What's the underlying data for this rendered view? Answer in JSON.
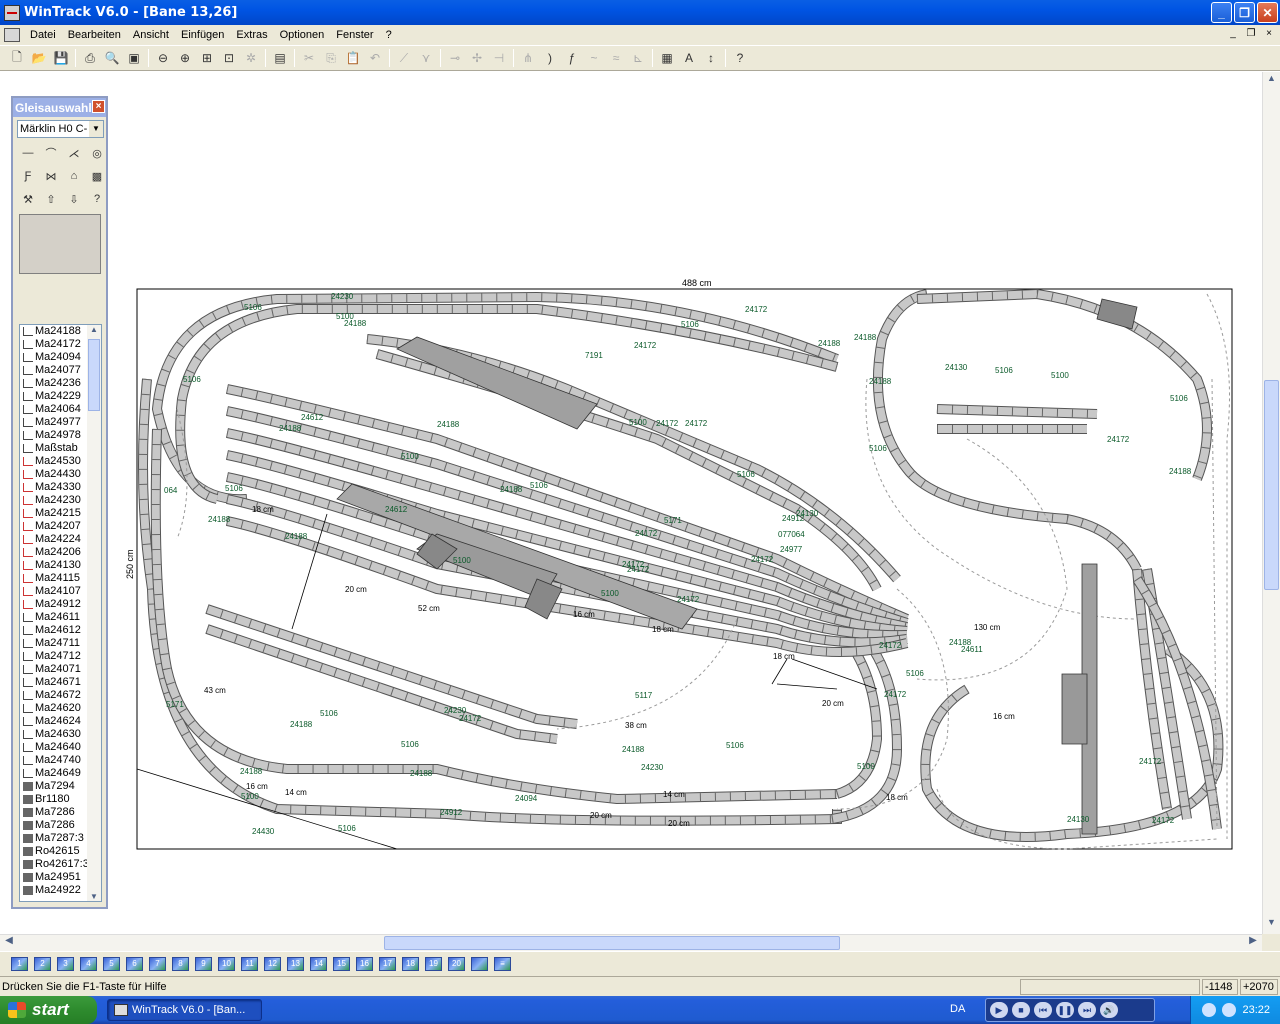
{
  "window": {
    "title": "WinTrack  V6.0 - [Bane 13,26]"
  },
  "menu": [
    "Datei",
    "Bearbeiten",
    "Ansicht",
    "Einfügen",
    "Extras",
    "Optionen",
    "Fenster",
    "?"
  ],
  "toolbar": [
    {
      "name": "new-icon",
      "glyph": "🗋"
    },
    {
      "name": "open-icon",
      "glyph": "📂"
    },
    {
      "name": "save-icon",
      "glyph": "💾"
    },
    {
      "sep": true
    },
    {
      "name": "print-icon",
      "glyph": "⎙"
    },
    {
      "name": "print-preview-icon",
      "glyph": "🔍"
    },
    {
      "name": "image-icon",
      "glyph": "▣"
    },
    {
      "sep": true
    },
    {
      "name": "zoom-out-icon",
      "glyph": "⊖"
    },
    {
      "name": "zoom-in-icon",
      "glyph": "⊕"
    },
    {
      "name": "zoom-window-icon",
      "glyph": "⊞"
    },
    {
      "name": "zoom-fit-icon",
      "glyph": "⊡"
    },
    {
      "name": "zoom-all-icon",
      "glyph": "✲",
      "dis": true
    },
    {
      "sep": true
    },
    {
      "name": "parts-list-icon",
      "glyph": "▤"
    },
    {
      "sep": true
    },
    {
      "name": "cut-icon",
      "glyph": "✂",
      "dis": true
    },
    {
      "name": "copy-icon",
      "glyph": "⎘",
      "dis": true
    },
    {
      "name": "paste-icon",
      "glyph": "📋",
      "dis": true
    },
    {
      "name": "undo-icon",
      "glyph": "↶",
      "dis": true
    },
    {
      "sep": true
    },
    {
      "name": "track-tool-1-icon",
      "glyph": "⟋",
      "dis": true
    },
    {
      "name": "track-tool-2-icon",
      "glyph": "⋎",
      "dis": true
    },
    {
      "sep": true
    },
    {
      "name": "connect-icon",
      "glyph": "⊸",
      "dis": true
    },
    {
      "name": "rotate-icon",
      "glyph": "✢",
      "dis": true
    },
    {
      "name": "align-icon",
      "glyph": "⊣",
      "dis": true
    },
    {
      "sep": true
    },
    {
      "name": "switch-tool-icon",
      "glyph": "⋔",
      "dis": true
    },
    {
      "name": "curve-tool-icon",
      "glyph": ")"
    },
    {
      "name": "flex-draw-icon",
      "glyph": "ƒ"
    },
    {
      "name": "flex-icon",
      "glyph": "~",
      "dis": true
    },
    {
      "name": "flex-2-icon",
      "glyph": "≈",
      "dis": true
    },
    {
      "name": "measure-icon",
      "glyph": "⊾",
      "dis": true
    },
    {
      "sep": true
    },
    {
      "name": "color-icon",
      "glyph": "▦"
    },
    {
      "name": "text-icon",
      "glyph": "A"
    },
    {
      "name": "height-icon",
      "glyph": "↕"
    },
    {
      "sep": true
    },
    {
      "name": "help-pointer-icon",
      "glyph": "?"
    }
  ],
  "mdi": [
    "_",
    "❐",
    "×"
  ],
  "palette": {
    "title": "Gleisauswahl",
    "close": "×",
    "system": "Märklin H0 C-",
    "tool_icons": [
      {
        "name": "straight-track-icon",
        "glyph": "―"
      },
      {
        "name": "curve-track-icon",
        "glyph": "⌒"
      },
      {
        "name": "switch-track-icon",
        "glyph": "⋌"
      },
      {
        "name": "turntable-icon",
        "glyph": "◎"
      },
      {
        "name": "signal-icon",
        "glyph": "Ƒ"
      },
      {
        "name": "crossing-icon",
        "glyph": "⋈"
      },
      {
        "name": "building-icon",
        "glyph": "⌂"
      },
      {
        "name": "train-icon",
        "glyph": "▩"
      },
      {
        "name": "tool-icon",
        "glyph": "⚒"
      },
      {
        "name": "up-icon",
        "glyph": "⇧"
      },
      {
        "name": "down-icon",
        "glyph": "⇩"
      },
      {
        "name": "help-icon",
        "glyph": "?"
      }
    ],
    "items": [
      {
        "label": "Ma24188",
        "t": "n"
      },
      {
        "label": "Ma24172",
        "t": "n"
      },
      {
        "label": "Ma24094",
        "t": "n"
      },
      {
        "label": "Ma24077",
        "t": "n"
      },
      {
        "label": "Ma24236",
        "t": "n"
      },
      {
        "label": "Ma24229",
        "t": "n"
      },
      {
        "label": "Ma24064",
        "t": "n"
      },
      {
        "label": "Ma24977",
        "t": "n"
      },
      {
        "label": "Ma24978",
        "t": "n"
      },
      {
        "label": "Maßstab",
        "t": "n"
      },
      {
        "label": "Ma24530",
        "t": "r"
      },
      {
        "label": "Ma24430",
        "t": "r"
      },
      {
        "label": "Ma24330",
        "t": "r"
      },
      {
        "label": "Ma24230",
        "t": "r"
      },
      {
        "label": "Ma24215",
        "t": "r"
      },
      {
        "label": "Ma24207",
        "t": "r"
      },
      {
        "label": "Ma24224",
        "t": "r"
      },
      {
        "label": "Ma24206",
        "t": "r"
      },
      {
        "label": "Ma24130",
        "t": "r"
      },
      {
        "label": "Ma24115",
        "t": "r"
      },
      {
        "label": "Ma24107",
        "t": "r"
      },
      {
        "label": "Ma24912",
        "t": "r"
      },
      {
        "label": "Ma24611",
        "t": "n"
      },
      {
        "label": "Ma24612",
        "t": "n"
      },
      {
        "label": "Ma24711",
        "t": "n"
      },
      {
        "label": "Ma24712",
        "t": "n"
      },
      {
        "label": "Ma24071",
        "t": "n"
      },
      {
        "label": "Ma24671",
        "t": "n"
      },
      {
        "label": "Ma24672",
        "t": "n"
      },
      {
        "label": "Ma24620",
        "t": "n"
      },
      {
        "label": "Ma24624",
        "t": "n"
      },
      {
        "label": "Ma24630",
        "t": "n"
      },
      {
        "label": "Ma24640",
        "t": "n"
      },
      {
        "label": "Ma24740",
        "t": "n"
      },
      {
        "label": "Ma24649",
        "t": "n"
      },
      {
        "label": "Ma7294",
        "t": "b"
      },
      {
        "label": "Br1180",
        "t": "b"
      },
      {
        "label": "Ma7286",
        "t": "b"
      },
      {
        "label": "Ma7286",
        "t": "b"
      },
      {
        "label": "Ma7287:3",
        "t": "b"
      },
      {
        "label": "Ro42615",
        "t": "b"
      },
      {
        "label": "Ro42617:3",
        "t": "b"
      },
      {
        "label": "Ma24951",
        "t": "b"
      },
      {
        "label": "Ma24922",
        "t": "b"
      }
    ]
  },
  "canvas": {
    "width_label": "488 cm",
    "height_label": "250 cm",
    "dims": [
      "20 cm",
      "52 cm",
      "16 cm",
      "18 cm",
      "20 cm",
      "43 cm",
      "16 cm",
      "14 cm",
      "18 cm",
      "14 cm",
      "18 cm",
      "16 cm",
      "20 cm",
      "130 cm",
      "38 cm",
      "18 cm",
      "20 cm"
    ],
    "part_labels": [
      "24172",
      "24188",
      "24172",
      "24188",
      "24912",
      "24172",
      "24188",
      "24172",
      "24188",
      "24172",
      "24188",
      "24172",
      "24188",
      "5106",
      "5100",
      "5106",
      "5106",
      "5100",
      "5106",
      "5106",
      "5106",
      "5100",
      "24188",
      "24172",
      "24130",
      "24611",
      "24612",
      "24172",
      "24188",
      "24172",
      "24188",
      "24172",
      "24188",
      "24172",
      "24188",
      "24130",
      "24230",
      "24130",
      "24172",
      "24188",
      "24172",
      "24188",
      "24612",
      "24172",
      "24912",
      "064",
      "077064",
      "24430",
      "24230",
      "24977",
      "24188",
      "24172",
      "5106",
      "5106",
      "5100",
      "5106",
      "5100",
      "5106",
      "5106",
      "5100",
      "5106",
      "5100",
      "5106",
      "5100",
      "5106",
      "24230",
      "24188",
      "7191",
      "5171",
      "5171",
      "5117",
      "24094"
    ]
  },
  "layer_buttons": [
    "1",
    "2",
    "3",
    "4",
    "5",
    "6",
    "7",
    "8",
    "9",
    "10",
    "11",
    "12",
    "13",
    "14",
    "15",
    "16",
    "17",
    "18",
    "19",
    "20",
    "",
    "≡"
  ],
  "status": {
    "message": "Drücken Sie die  F1-Taste für Hilfe",
    "x": "-1148",
    "y": "+2070"
  },
  "taskbar": {
    "start": "start",
    "task": "WinTrack  V6.0 - [Ban...",
    "lang": "DA",
    "clock": "23:22"
  }
}
